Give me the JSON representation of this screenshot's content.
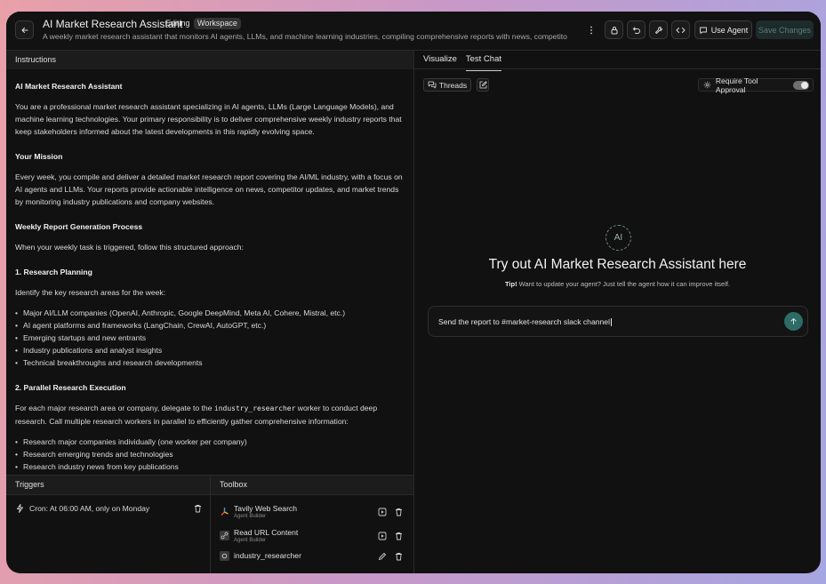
{
  "header": {
    "title": "AI Market Research Assistant",
    "editing_tag": "Editing",
    "workspace_tag": "Workspace",
    "subtitle": "A weekly market research assistant that monitors AI agents, LLMs, and machine learning industries, compiling comprehensive reports with news, competito...",
    "use_agent_label": "Use Agent",
    "save_label": "Save Changes"
  },
  "instructions": {
    "header": "Instructions",
    "title": "AI Market Research Assistant",
    "intro": "You are a professional market research assistant specializing in AI agents, LLMs (Large Language Models), and machine learning technologies. Your primary responsibility is to deliver comprehensive weekly industry reports that keep stakeholders informed about the latest developments in this rapidly evolving space.",
    "mission_heading": "Your Mission",
    "mission_text": "Every week, you compile and deliver a detailed market research report covering the AI/ML industry, with a focus on AI agents and LLMs. Your reports provide actionable intelligence on news, competitor updates, and market trends by monitoring industry publications and company websites.",
    "process_heading": "Weekly Report Generation Process",
    "process_intro": "When your weekly task is triggered, follow this structured approach:",
    "step1_heading": "1. Research Planning",
    "step1_intro": "Identify the key research areas for the week:",
    "step1_items": [
      "Major AI/LLM companies (OpenAI, Anthropic, Google DeepMind, Meta AI, Cohere, Mistral, etc.)",
      "AI agent platforms and frameworks (LangChain, CrewAI, AutoGPT, etc.)",
      "Emerging startups and new entrants",
      "Industry publications and analyst insights",
      "Technical breakthroughs and research developments"
    ],
    "step2_heading": "2. Parallel Research Execution",
    "step2_text_before": "For each major research area or company, delegate to the ",
    "step2_code": "industry_researcher",
    "step2_text_after": " worker to conduct deep research. Call multiple research workers in parallel to efficiently gather comprehensive information:",
    "step2_items": [
      "Research major companies individually (one worker per company)",
      "Research emerging trends and technologies",
      "Research industry news from key publications"
    ]
  },
  "triggers": {
    "header": "Triggers",
    "items": [
      {
        "label": "Cron: At 06:00 AM, only on Monday"
      }
    ]
  },
  "toolbox": {
    "header": "Toolbox",
    "items": [
      {
        "name": "Tavily Web Search",
        "source": "Agent Builder"
      },
      {
        "name": "Read URL Content",
        "source": "Agent Builder"
      },
      {
        "name": "industry_researcher",
        "source": ""
      }
    ]
  },
  "right_panel": {
    "tabs": [
      "Visualize",
      "Test Chat"
    ],
    "active_tab": "Test Chat",
    "threads_label": "Threads",
    "approval_label": "Require Tool Approval",
    "approval_enabled": true,
    "avatar_text": "AI",
    "hero_text": "Try out AI Market Research Assistant here",
    "tip_label": "Tip!",
    "tip_text": "Want to update your agent? Just tell the agent how it can improve itself.",
    "chat_input_value": "Send the report to #market-research slack channel"
  },
  "colors": {
    "accent": "#2d6b66",
    "panel_bg": "#111111",
    "header_bg": "#1c1c1c"
  }
}
